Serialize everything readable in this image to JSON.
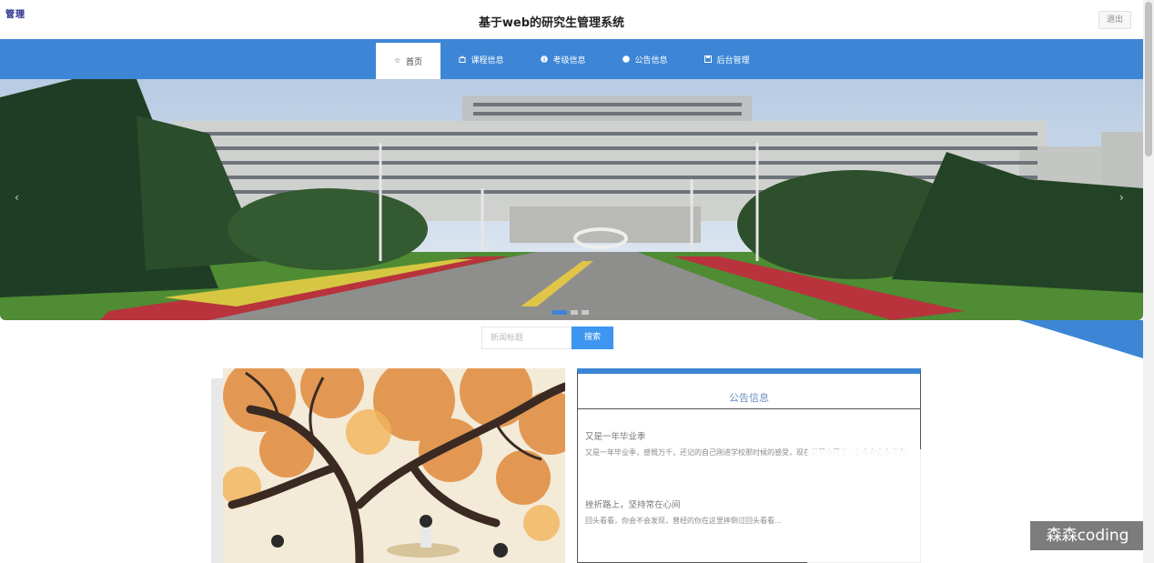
{
  "header": {
    "user_tag": "管理",
    "title": "基于web的研究生管理系统",
    "logout_label": "退出"
  },
  "nav": {
    "items": [
      {
        "label": "首页",
        "icon": "star-icon",
        "active": true
      },
      {
        "label": "课程信息",
        "icon": "bag-icon",
        "active": false
      },
      {
        "label": "考级信息",
        "icon": "info-icon",
        "active": false
      },
      {
        "label": "公告信息",
        "icon": "circle-icon",
        "active": false
      },
      {
        "label": "后台管理",
        "icon": "save-icon",
        "active": false
      }
    ]
  },
  "banner": {
    "slide_count": 3,
    "active_slide": 1
  },
  "search": {
    "placeholder": "新闻标题",
    "button_label": "搜索"
  },
  "notice": {
    "title": "公告信息",
    "items": [
      {
        "title": "又是一年毕业季",
        "body": "又是一年毕业季，感慨万千，还记的自己刚进学校那时候的感受，现在就要离开了，心中有太多不舍。"
      },
      {
        "title": "挫折路上，坚持常在心间",
        "body": "回头看看，你会不会发现，曾经的你在这里摔倒过回头看看..."
      }
    ]
  },
  "watermark": "森森coding",
  "colors": {
    "primary": "#3d86d6",
    "button": "#3d97f0",
    "notice_title": "#6b8fbf"
  }
}
